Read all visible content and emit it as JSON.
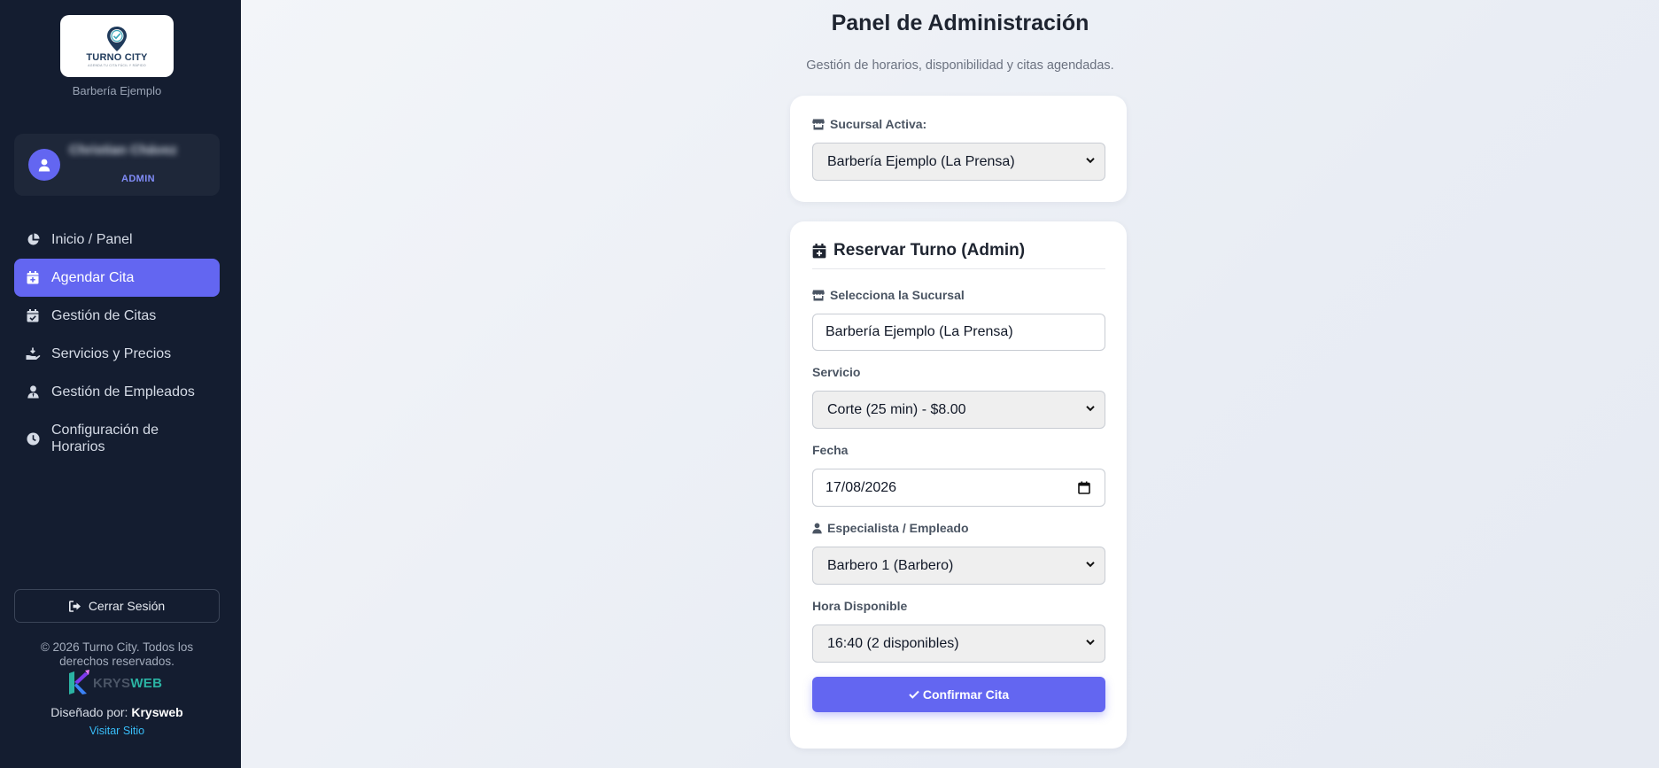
{
  "brand": {
    "logo_text": "TURNO CITY",
    "logo_sub": "AGENDA TU CITA FÁCIL Y RÁPIDO",
    "business_name": "Barbería Ejemplo"
  },
  "user": {
    "name": "Christian Chávez",
    "role": "ADMIN"
  },
  "nav": {
    "items": [
      {
        "label": "Inicio / Panel",
        "icon": "pie-chart-icon",
        "active": false
      },
      {
        "label": "Agendar Cita",
        "icon": "calendar-plus-icon",
        "active": true
      },
      {
        "label": "Gestión de Citas",
        "icon": "calendar-check-icon",
        "active": false
      },
      {
        "label": "Servicios y Precios",
        "icon": "hand-holding-icon",
        "active": false
      },
      {
        "label": "Gestión de Empleados",
        "icon": "user-tie-icon",
        "active": false
      },
      {
        "label": "Configuración de Horarios",
        "icon": "clock-icon",
        "active": false
      }
    ]
  },
  "footer": {
    "logout_label": "Cerrar Sesión",
    "copyright": "© 2026 Turno City. Todos los derechos reservados.",
    "krys_a": "KRYS",
    "krys_b": "WEB",
    "designed_prefix": "Diseñado por:",
    "designed_name": "Krysweb",
    "visit_label": "Visitar Sitio"
  },
  "header": {
    "title": "Panel de Administración",
    "subtitle": "Gestión de horarios, disponibilidad y citas agendadas."
  },
  "branch_card": {
    "label": "Sucursal Activa:",
    "selected": "Barbería Ejemplo (La Prensa)"
  },
  "booking": {
    "title": "Reservar Turno (Admin)",
    "branch_label": "Selecciona la Sucursal",
    "branch_value": "Barbería Ejemplo (La Prensa)",
    "service_label": "Servicio",
    "service_value": "Corte (25 min) - $8.00",
    "date_label": "Fecha",
    "date_value": "17/08/2026",
    "employee_label": "Especialista / Empleado",
    "employee_value": "Barbero 1 (Barbero)",
    "time_label": "Hora Disponible",
    "time_value": "16:40 (2 disponibles)",
    "confirm_label": "Confirmar Cita"
  },
  "colors": {
    "sidebar_bg": "#141d30",
    "accent": "#6366f1"
  }
}
